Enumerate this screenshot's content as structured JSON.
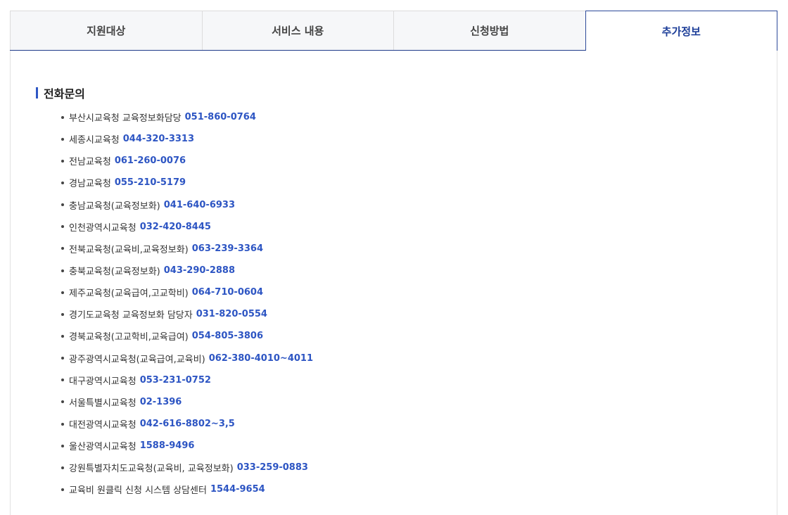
{
  "tabs": [
    {
      "label": "지원대상",
      "active": false
    },
    {
      "label": "서비스 내용",
      "active": false
    },
    {
      "label": "신청방법",
      "active": false
    },
    {
      "label": "추가정보",
      "active": true
    }
  ],
  "section": {
    "title": "전화문의"
  },
  "contacts": [
    {
      "name": "부산시교육청 교육정보화담당",
      "phone": "051-860-0764"
    },
    {
      "name": "세종시교육청",
      "phone": "044-320-3313"
    },
    {
      "name": "전남교육청",
      "phone": "061-260-0076"
    },
    {
      "name": "경남교육청",
      "phone": "055-210-5179"
    },
    {
      "name": "충남교육청(교육정보화)",
      "phone": "041-640-6933"
    },
    {
      "name": "인천광역시교육청",
      "phone": "032-420-8445"
    },
    {
      "name": "전북교육청(교육비,교육정보화)",
      "phone": "063-239-3364"
    },
    {
      "name": "충북교육청(교육정보화)",
      "phone": "043-290-2888"
    },
    {
      "name": "제주교육청(교육급여,고교학비)",
      "phone": "064-710-0604"
    },
    {
      "name": "경기도교육청 교육정보화 담당자",
      "phone": "031-820-0554"
    },
    {
      "name": "경북교육청(고교학비,교육급여)",
      "phone": "054-805-3806"
    },
    {
      "name": "광주광역시교육청(교육급여,교육비)",
      "phone": "062-380-4010~4011"
    },
    {
      "name": "대구광역시교육청",
      "phone": "053-231-0752"
    },
    {
      "name": "서울특별시교육청",
      "phone": "02-1396"
    },
    {
      "name": "대전광역시교육청",
      "phone": "042-616-8802~3,5"
    },
    {
      "name": "울산광역시교육청",
      "phone": "1588-9496"
    },
    {
      "name": "강원특별자치도교육청(교육비, 교육정보화)",
      "phone": "033-259-0883"
    },
    {
      "name": "교육비 원클릭 신청 시스템 상담센터",
      "phone": "1544-9654"
    }
  ],
  "colors": {
    "accent": "#2d55c3",
    "active_tab_text": "#1e3f99",
    "tab_bg": "#f6f7f9"
  }
}
